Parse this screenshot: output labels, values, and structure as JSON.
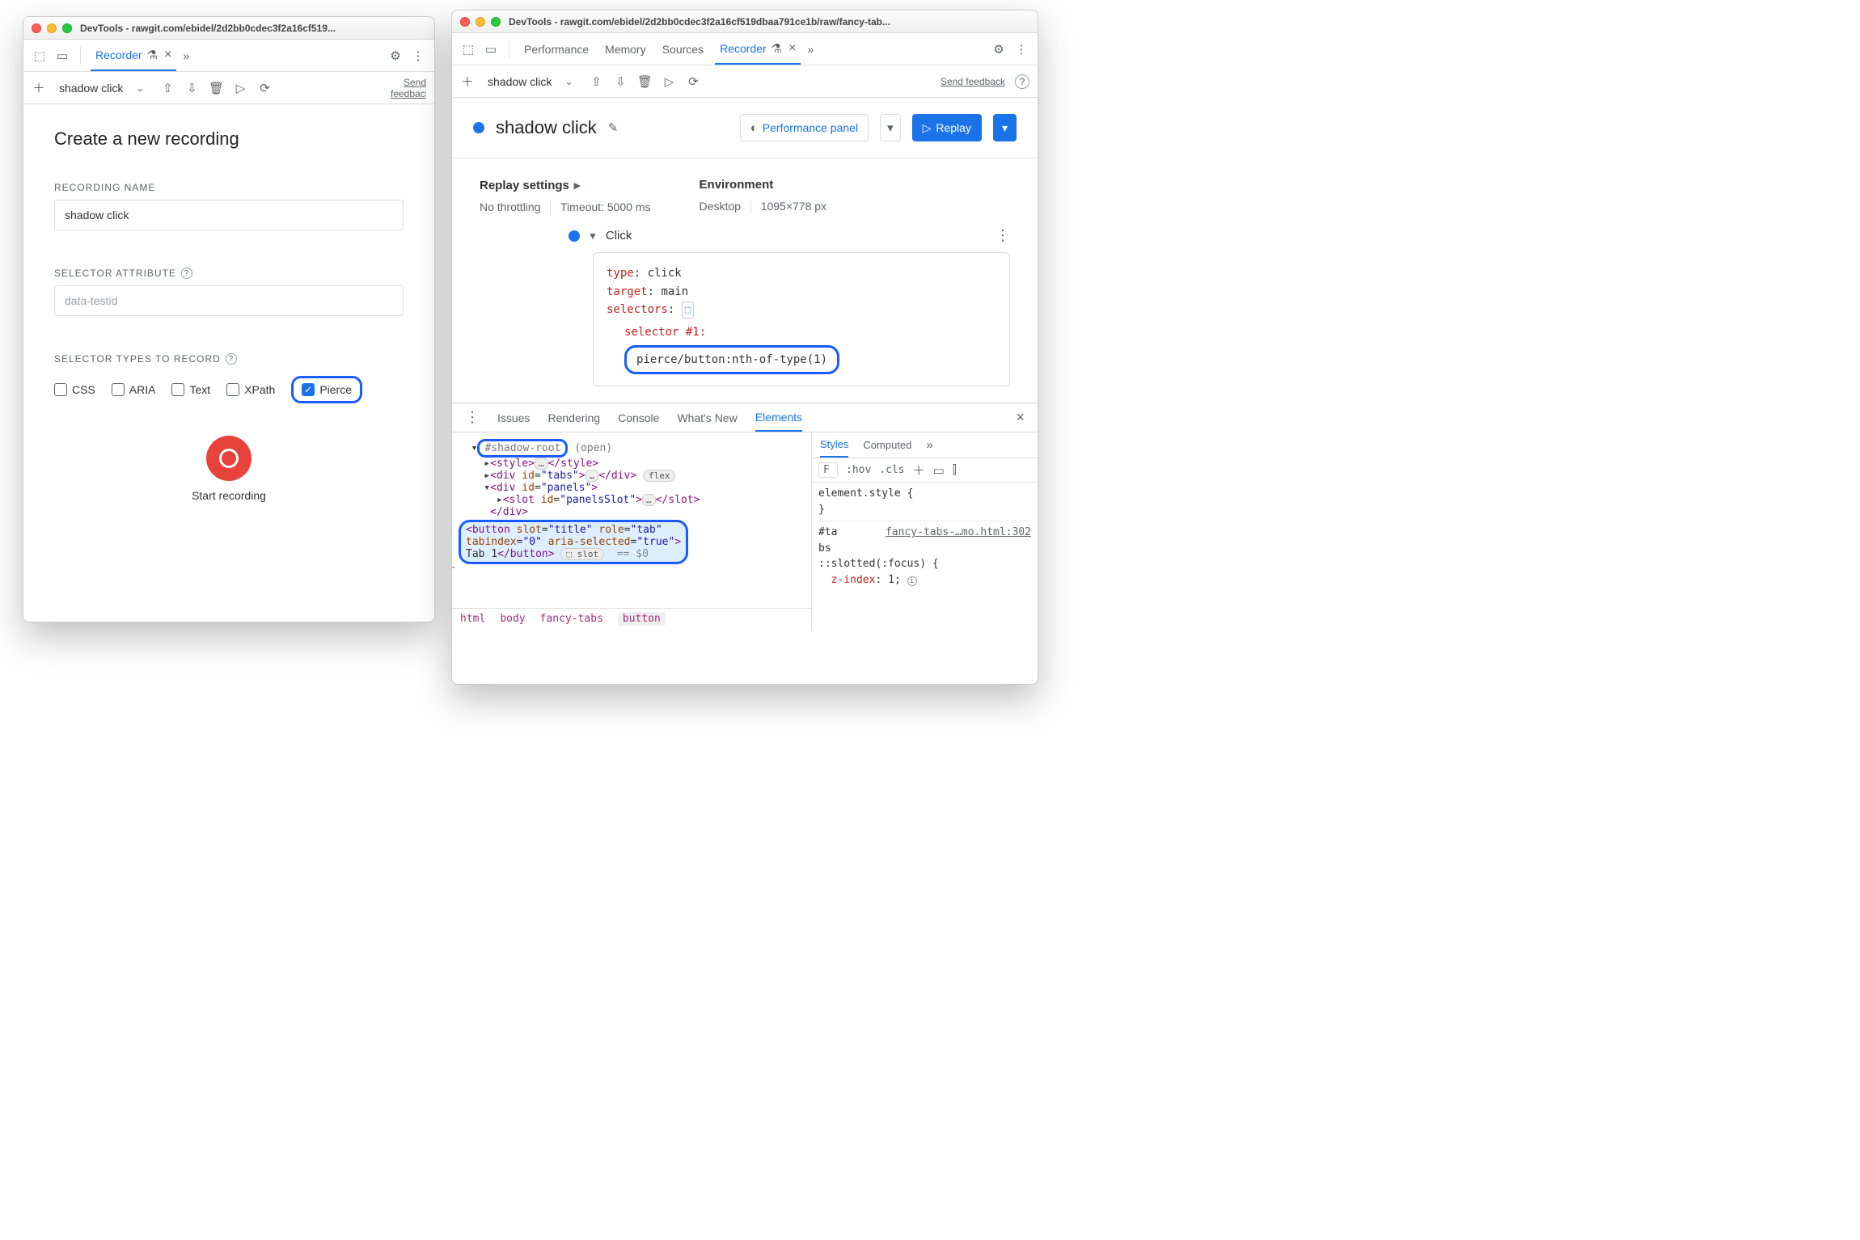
{
  "left": {
    "title_prefix": "DevTools - ",
    "title_url": "rawgit.com/ebidel/2d2bb0cdec3f2a16cf519...",
    "tab_recorder": "Recorder",
    "toolbar_name": "shadow click",
    "send_feedback": "Send feedback",
    "heading": "Create a new recording",
    "label_name": "RECORDING NAME",
    "input_name_value": "shadow click",
    "label_attr": "SELECTOR ATTRIBUTE",
    "input_attr_placeholder": "data-testid",
    "label_types": "SELECTOR TYPES TO RECORD",
    "types": {
      "css": "CSS",
      "aria": "ARIA",
      "text": "Text",
      "xpath": "XPath",
      "pierce": "Pierce"
    },
    "start_recording": "Start recording"
  },
  "right": {
    "title_prefix": "DevTools - ",
    "title_url": "rawgit.com/ebidel/2d2bb0cdec3f2a16cf519dbaa791ce1b/raw/fancy-tab...",
    "tabs": {
      "performance": "Performance",
      "memory": "Memory",
      "sources": "Sources",
      "recorder": "Recorder"
    },
    "toolbar_name": "shadow click",
    "send_feedback": "Send feedback",
    "header_name": "shadow click",
    "perf_panel": "Performance panel",
    "replay": "Replay",
    "replay_settings": "Replay settings",
    "no_throttling": "No throttling",
    "timeout": "Timeout: 5000 ms",
    "environment": "Environment",
    "env_device": "Desktop",
    "env_size": "1095×778 px",
    "step_title": "Click",
    "step": {
      "k_type": "type",
      "v_type": "click",
      "k_target": "target",
      "v_target": "main",
      "k_selectors": "selectors",
      "selector_num": "selector #1",
      "selector_val": "pierce/button:nth-of-type(1)"
    },
    "drawer_tabs": {
      "issues": "Issues",
      "rendering": "Rendering",
      "console": "Console",
      "whatsnew": "What's New",
      "elements": "Elements"
    },
    "dom": {
      "shadow_root": "#shadow-root",
      "shadow_open": "(open)",
      "tabs_id": "tabs",
      "panels_id": "panels",
      "slot_id": "panelsSlot",
      "flex_badge": "flex",
      "slot_badge": "slot",
      "eq0": "== $0",
      "button_line1": "<button slot=\"title\" role=\"tab\"",
      "button_line2": "tabindex=\"0\" aria-selected=\"true\">",
      "button_text": "Tab 1",
      "button_close": "</button>"
    },
    "breadcrumb": {
      "html": "html",
      "body": "body",
      "fancy": "fancy-tabs",
      "button": "button"
    },
    "styles": {
      "tab_styles": "Styles",
      "tab_computed": "Computed",
      "filter": "F",
      "hov": ":hov",
      "cls": ".cls",
      "element_style": "element.style {",
      "brace_close": "}",
      "sel": "#ta\nbs",
      "src": "fancy-tabs-…mo.html:302",
      "slotted": "::slotted(:focus) {",
      "zindex_k": "z-index",
      "zindex_v": "1"
    }
  }
}
